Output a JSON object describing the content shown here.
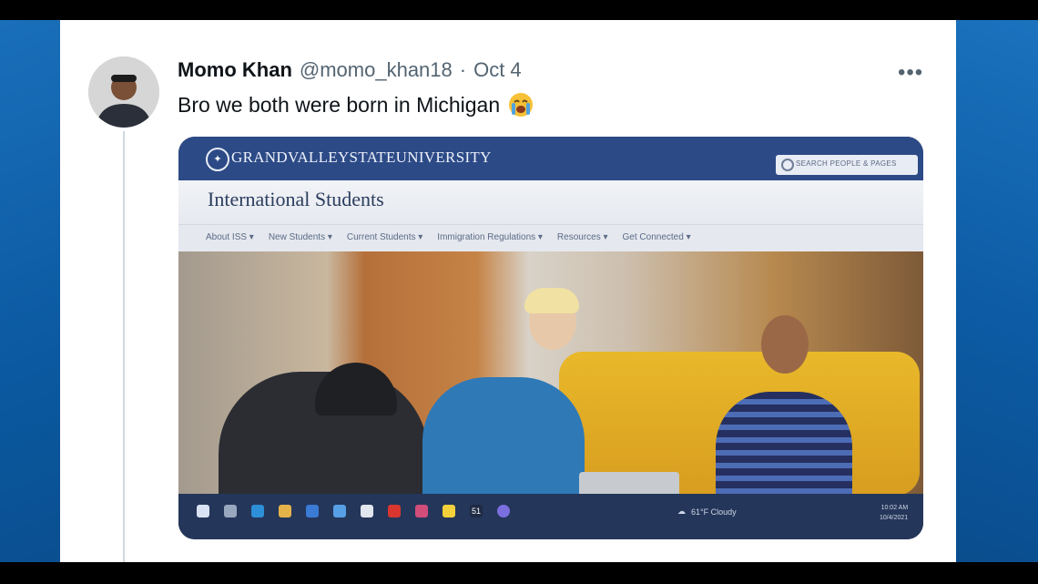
{
  "tweet": {
    "display_name": "Momo Khan",
    "handle": "@momo_khan18",
    "separator": "·",
    "date": "Oct 4",
    "text": "Bro we both were born in Michigan",
    "emoji": "loudly-crying-face-emoji",
    "more_label": "•••"
  },
  "screenshot": {
    "university_name": "GRANDVALLEYSTATEUNIVERSITY",
    "search_placeholder": "SEARCH PEOPLE & PAGES",
    "page_title": "International Students",
    "nav": [
      "About ISS ▾",
      "New Students ▾",
      "Current Students ▾",
      "Immigration Regulations ▾",
      "Resources ▾",
      "Get Connected ▾"
    ],
    "taskbar": {
      "weather": "61°F Cloudy",
      "time": "10:02 AM",
      "date": "10/4/2021",
      "window_label": "51"
    }
  },
  "colors": {
    "brand_blue": "#2c4a86",
    "tweet_text": "#0f1419",
    "muted": "#536471"
  }
}
